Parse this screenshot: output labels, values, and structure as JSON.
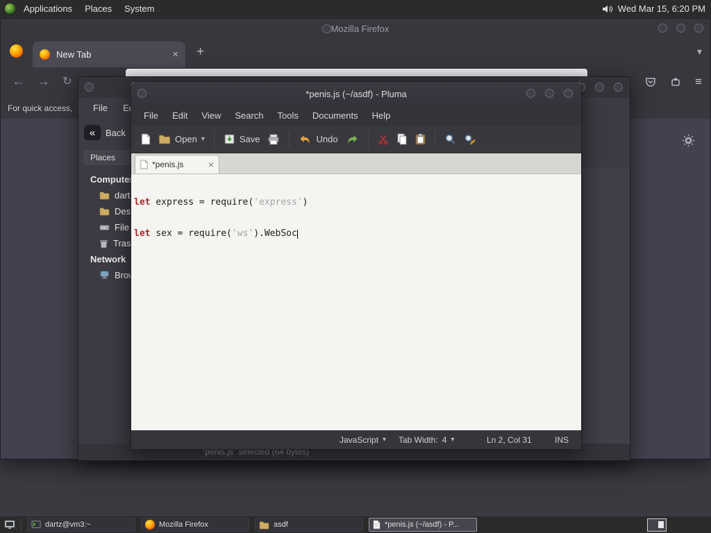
{
  "icons": {
    "close": "×",
    "plus": "+",
    "chevron_down": "▾",
    "back_arrow": "←",
    "forward_arrow": "→",
    "reload_arrow": "↻",
    "hamburger": "≡",
    "caja_back": "«"
  },
  "top_panel": {
    "menu_applications": "Applications",
    "menu_places": "Places",
    "menu_system": "System",
    "clock": "Wed Mar 15, 6:20 PM"
  },
  "firefox": {
    "window_title": "Mozilla Firefox",
    "tab_title": "New Tab",
    "bookmarks_hint": "For quick access,"
  },
  "file_manager": {
    "menu_file": "File",
    "menu_edit": "Edit",
    "back_label": "Back",
    "places_label": "Places",
    "sidebar": [
      {
        "label": "Computer"
      },
      {
        "label": "dartz"
      },
      {
        "label": "Desktop"
      },
      {
        "label": "File System"
      },
      {
        "label": "Trash"
      },
      {
        "label": "Network"
      },
      {
        "label": "Browse Network"
      }
    ],
    "status_text": "\"penis.js\" selected (64 bytes)"
  },
  "pluma": {
    "window_title": "*penis.js (~/asdf) - Pluma",
    "menus": [
      "File",
      "Edit",
      "View",
      "Search",
      "Tools",
      "Documents",
      "Help"
    ],
    "toolbar": {
      "open_label": "Open",
      "save_label": "Save",
      "undo_label": "Undo"
    },
    "tab_label": "*penis.js",
    "code": {
      "l1_kw": "let",
      "l1_mid": " express = require(",
      "l1_str": "'express'",
      "l1_end": ")",
      "l2_kw": "let",
      "l2_mid": " sex = require(",
      "l2_str": "'ws'",
      "l2_end": ").WebSoc"
    },
    "status": {
      "language": "JavaScript",
      "tab_width_label": "Tab Width:",
      "tab_width_value": "4",
      "position": "Ln 2, Col 31",
      "mode": "INS"
    }
  },
  "taskbar": {
    "items": [
      {
        "label": "dartz@vm3:~"
      },
      {
        "label": "Mozilla Firefox"
      },
      {
        "label": "asdf"
      },
      {
        "label": "*penis.js (~/asdf) - P..."
      }
    ]
  }
}
